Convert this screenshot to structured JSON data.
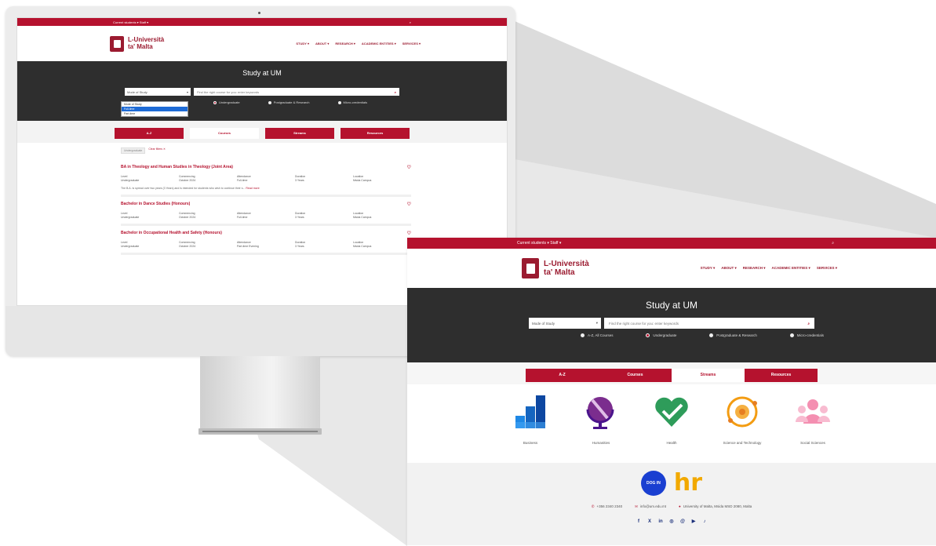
{
  "site": {
    "topbar": {
      "links": "Current students ▾   Staff ▾",
      "search_icon": "search-icon"
    },
    "logo": {
      "line1": "L-Università",
      "line2": "ta' Malta"
    },
    "nav": [
      "STUDY ▾",
      "ABOUT ▾",
      "RESEARCH ▾",
      "ACADEMIC ENTITIES ▾",
      "SERVICES ▾"
    ],
    "hero": {
      "title": "Study at UM",
      "select_value": "Mode of Study",
      "search_placeholder": "Find the right course for you: enter keywords",
      "radios": [
        "A-Z, All Courses",
        "Undergraduate",
        "Postgraduate & Research",
        "Micro-credentials"
      ]
    },
    "tabs": [
      "A-Z",
      "Courses",
      "Streams",
      "Resources"
    ]
  },
  "small": {
    "dropdown": [
      "Mode of Study",
      "Full-time",
      "Part-time"
    ],
    "chips": [
      "Undergraduate",
      "Clear filters ✕"
    ],
    "courses": [
      {
        "title": "BA in Theology and Human Studies in Theology (Joint Area)",
        "labels": [
          "Level",
          "Commencing",
          "Attendance",
          "Duration",
          "Location"
        ],
        "values": [
          "Undergraduate",
          "October 2024",
          "Full-time",
          "3 Years",
          "Msida Campus"
        ],
        "desc": "The B.A. is spread over two years (3 Years) and is intended for students who wish to continue their s...",
        "read_more": "Read more"
      },
      {
        "title": "Bachelor in Dance Studies (Honours)",
        "labels": [
          "Level",
          "Commencing",
          "Attendance",
          "Duration",
          "Location"
        ],
        "values": [
          "Undergraduate",
          "October 2024",
          "Full-time",
          "3 Years",
          "Msida Campus"
        ]
      },
      {
        "title": "Bachelor in Occupational Health and Safety (Honours)",
        "labels": [
          "Level",
          "Commencing",
          "Attendance",
          "Duration",
          "Location"
        ],
        "values": [
          "Undergraduate",
          "October 2024",
          "Part-time Evening",
          "3 Years",
          "Msida Campus"
        ]
      }
    ]
  },
  "large": {
    "streams": [
      {
        "label": "Business",
        "icon": "bar-chart-icon"
      },
      {
        "label": "Humanities",
        "icon": "globe-pen-icon"
      },
      {
        "label": "Health",
        "icon": "heart-check-icon"
      },
      {
        "label": "Science and Technology",
        "icon": "atom-icon"
      },
      {
        "label": "Social Sciences",
        "icon": "people-icon"
      }
    ],
    "footer": {
      "badge_text": "DOG IN",
      "hr_logo": "hr",
      "phone": "+356 2340 2340",
      "email": "info@um.edu.mt",
      "address": "University of Malta, Msida MSD 2080, Malta",
      "social": [
        "facebook-icon",
        "x-icon",
        "linkedin-icon",
        "instagram-icon",
        "threads-icon",
        "youtube-icon",
        "tiktok-icon"
      ]
    }
  },
  "colors": {
    "brand_red": "#b5122e",
    "hero_dark": "#2e2e2e"
  }
}
